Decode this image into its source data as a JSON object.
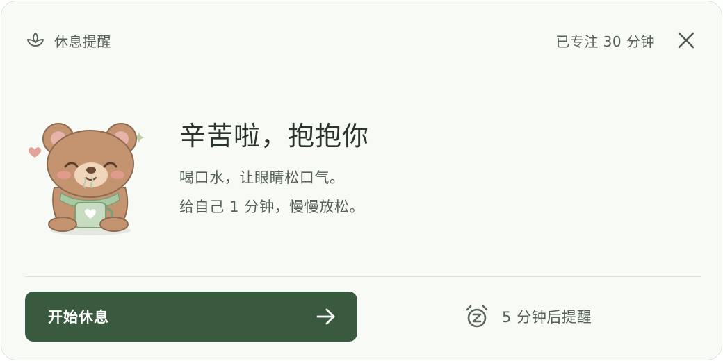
{
  "header": {
    "app_title": "休息提醒",
    "focus_text": "已专注 30 分钟"
  },
  "message": {
    "headline": "辛苦啦，抱抱你",
    "line1": "喝口水，让眼睛松口气。",
    "line2": "给自己 1 分钟，慢慢放松。"
  },
  "actions": {
    "start_label": "开始休息",
    "snooze_label": "5 分钟后提醒"
  },
  "icons": {
    "app": "leaf-icon",
    "close": "close-icon",
    "arrow": "arrow-right-icon",
    "snooze": "alarm-clock-snooze-icon",
    "illustration": "bear-with-cup-illustration"
  },
  "colors": {
    "card_background": "#f7faf5",
    "primary_green": "#3a5a40",
    "text_dark": "#2b342c",
    "text_muted": "#556057"
  }
}
